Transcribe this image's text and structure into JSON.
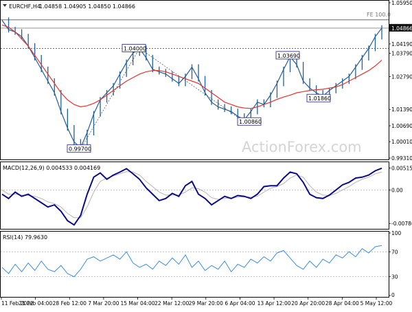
{
  "header": {
    "symbol": "EURCHF,H4",
    "ohlc": "1.04858 1.04905 1.04850 1.04866"
  },
  "watermark": "ActionForex.com",
  "colors": {
    "price": "#1f5f9a",
    "ma": "#e8322c",
    "macd": "#0b0b8a",
    "signal": "#b5b5b5",
    "rsi": "#3a8ee0",
    "grid": "#a0a0a0",
    "label_border": "#1a1a8a"
  },
  "chart_data": [
    {
      "type": "line",
      "panel": "price",
      "ylim": [
        0.9931,
        1.0595
      ],
      "y_ticks": [
        "1.05950",
        "1.04866",
        "1.04190",
        "1.03790",
        "1.02790",
        "1.01390",
        "1.00690",
        "1.00010",
        "0.99310"
      ],
      "current_price": "1.04866",
      "fe_label": "FE 100.0",
      "fe_level": 1.0522,
      "horizontal_level": 1.04,
      "x_ticks": [
        "11 Feb 2022",
        "21 Feb 04:00",
        "28 Feb 12:00",
        "7 Mar 20:00",
        "15 Mar 04:00",
        "22 Mar 12:00",
        "29 Mar 20:00",
        "6 Apr 04:00",
        "13 Apr 12:00",
        "20 Apr 20:00",
        "28 Apr 04:00",
        "5 May 12:00"
      ],
      "price_labels": [
        {
          "text": "0.99700",
          "value": 0.997
        },
        {
          "text": "1.04000",
          "value": 1.04
        },
        {
          "text": "1.00860",
          "value": 1.0086
        },
        {
          "text": "1.03690",
          "value": 1.0369
        },
        {
          "text": "1.01860",
          "value": 1.0186
        }
      ],
      "series": [
        {
          "values": [
            1.052,
            1.048,
            1.047,
            1.045,
            1.041,
            1.036,
            1.031,
            1.026,
            1.021,
            1.013,
            1.006,
            1.0,
            0.9975,
            1.004,
            1.012,
            1.018,
            1.021,
            1.024,
            1.029,
            1.034,
            1.038,
            1.04,
            1.036,
            1.031,
            1.03,
            1.029,
            1.027,
            1.025,
            1.028,
            1.032,
            1.027,
            1.021,
            1.017,
            1.015,
            1.014,
            1.013,
            1.011,
            1.0095,
            1.013,
            1.017,
            1.016,
            1.02,
            1.025,
            1.031,
            1.0365,
            1.033,
            1.026,
            1.023,
            1.021,
            1.0195,
            1.022,
            1.024,
            1.026,
            1.028,
            1.032,
            1.036,
            1.04,
            1.045,
            1.0487
          ]
        },
        {
          "values": [
            1.05,
            1.049,
            1.047,
            1.044,
            1.041,
            1.037,
            1.033,
            1.029,
            1.025,
            1.021,
            1.018,
            1.016,
            1.015,
            1.0155,
            1.0165,
            1.018,
            1.02,
            1.022,
            1.024,
            1.026,
            1.0275,
            1.029,
            1.03,
            1.0305,
            1.0305,
            1.03,
            1.029,
            1.028,
            1.027,
            1.026,
            1.025,
            1.023,
            1.021,
            1.019,
            1.017,
            1.016,
            1.015,
            1.0145,
            1.0143,
            1.015,
            1.016,
            1.017,
            1.0182,
            1.0192,
            1.02,
            1.021,
            1.0215,
            1.022,
            1.0223,
            1.0225,
            1.023,
            1.0235,
            1.0245,
            1.026,
            1.0275,
            1.029,
            1.0305,
            1.0325,
            1.035
          ]
        }
      ]
    },
    {
      "type": "line",
      "panel": "macd",
      "title": "MACD(12,26,9) 0.004533 0.004169",
      "ylim": [
        -0.0088,
        0.0062
      ],
      "y_ticks": [
        "0.005151",
        "0.00",
        "-0.007869"
      ],
      "series": [
        {
          "values": [
            -0.001,
            -0.002,
            -0.0005,
            -0.0015,
            -0.001,
            -0.002,
            -0.003,
            -0.004,
            -0.0035,
            -0.005,
            -0.0072,
            -0.0082,
            -0.006,
            -0.001,
            0.003,
            0.004,
            0.0025,
            0.0035,
            0.0042,
            0.005,
            0.0038,
            0.0025,
            0.0005,
            -0.001,
            -0.0025,
            -0.002,
            -0.0008,
            -0.0015,
            0.001,
            0.002,
            -0.001,
            -0.002,
            -0.0035,
            -0.0025,
            -0.0015,
            -0.002,
            -0.0013,
            -0.0015,
            -0.002,
            -0.001,
            0.0008,
            0.001,
            0.001,
            0.0028,
            0.0042,
            0.0038,
            0.0018,
            -0.001,
            -0.0018,
            -0.002,
            -0.0012,
            0.0,
            0.0012,
            0.0018,
            0.0028,
            0.003,
            0.0035,
            0.0045,
            0.0051
          ]
        },
        {
          "values": [
            0.0,
            -0.001,
            -0.001,
            -0.0012,
            -0.0013,
            -0.0015,
            -0.002,
            -0.0028,
            -0.0032,
            -0.004,
            -0.0055,
            -0.0065,
            -0.0065,
            -0.004,
            -0.0005,
            0.002,
            0.0028,
            0.0033,
            0.0038,
            0.0043,
            0.0042,
            0.0035,
            0.002,
            0.0008,
            -0.0005,
            -0.0012,
            -0.0012,
            -0.0012,
            -0.0005,
            0.0005,
            0.0003,
            -0.0005,
            -0.0018,
            -0.0022,
            -0.002,
            -0.0019,
            -0.0017,
            -0.0016,
            -0.0017,
            -0.0015,
            -0.0005,
            0.0004,
            0.0008,
            0.0015,
            0.0028,
            0.0035,
            0.003,
            0.001,
            -0.0005,
            -0.0012,
            -0.0013,
            -0.0008,
            0.0,
            0.0008,
            0.0018,
            0.0025,
            0.003,
            0.0038,
            0.0042
          ]
        }
      ]
    },
    {
      "type": "line",
      "panel": "rsi",
      "title": "RSI(14) 79.9630",
      "ylim": [
        0,
        100
      ],
      "y_ticks": [
        "100",
        "70",
        "30",
        "0"
      ],
      "levels": [
        70,
        30
      ],
      "series": [
        {
          "values": [
            45,
            35,
            50,
            38,
            52,
            40,
            55,
            42,
            38,
            48,
            35,
            30,
            42,
            58,
            62,
            55,
            60,
            65,
            58,
            70,
            52,
            45,
            50,
            42,
            55,
            48,
            60,
            50,
            65,
            45,
            55,
            40,
            48,
            42,
            55,
            38,
            50,
            45,
            58,
            52,
            62,
            55,
            68,
            72,
            60,
            48,
            42,
            55,
            45,
            58,
            52,
            65,
            60,
            70,
            62,
            75,
            68,
            78,
            80
          ]
        }
      ]
    }
  ]
}
